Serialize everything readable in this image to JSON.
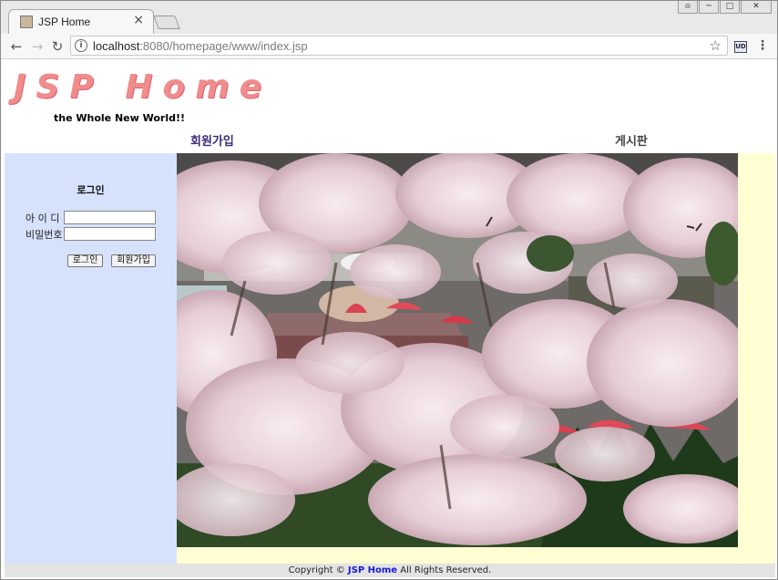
{
  "browser": {
    "tab_title": "JSP Home",
    "tab_close": "×",
    "url_host": "localhost",
    "url_rest": ":8080/homepage/www/index.jsp",
    "nav": {
      "back": "←",
      "forward": "→",
      "reload": "↻"
    },
    "window_controls": [
      "⍝",
      "─",
      "□",
      "✕"
    ],
    "icons": [
      "info-icon",
      "star-icon",
      "extension-icon",
      "menu-icon"
    ]
  },
  "site": {
    "logo_title": "JSP Home",
    "logo_subtitle": "the Whole New World!!",
    "menu": {
      "join": "회원가입",
      "board": "게시판"
    }
  },
  "login": {
    "title": "로그인",
    "id_label": "아 이 디",
    "pw_label": "비밀번호",
    "id_value": "",
    "pw_value": "",
    "login_button": "로그인",
    "join_button": "회원가입"
  },
  "main_image": {
    "description_icon": "cherry-blossom-photo"
  },
  "footer": {
    "prefix": "Copyright ©",
    "brand": "JSP Home",
    "suffix": "All Rights Reserved."
  },
  "colors": {
    "sidebar_bg": "#d6e2fc",
    "content_bg": "#ffffd3",
    "logo_pink": "#f08c8c",
    "footer_brand": "#1a1ad8"
  }
}
